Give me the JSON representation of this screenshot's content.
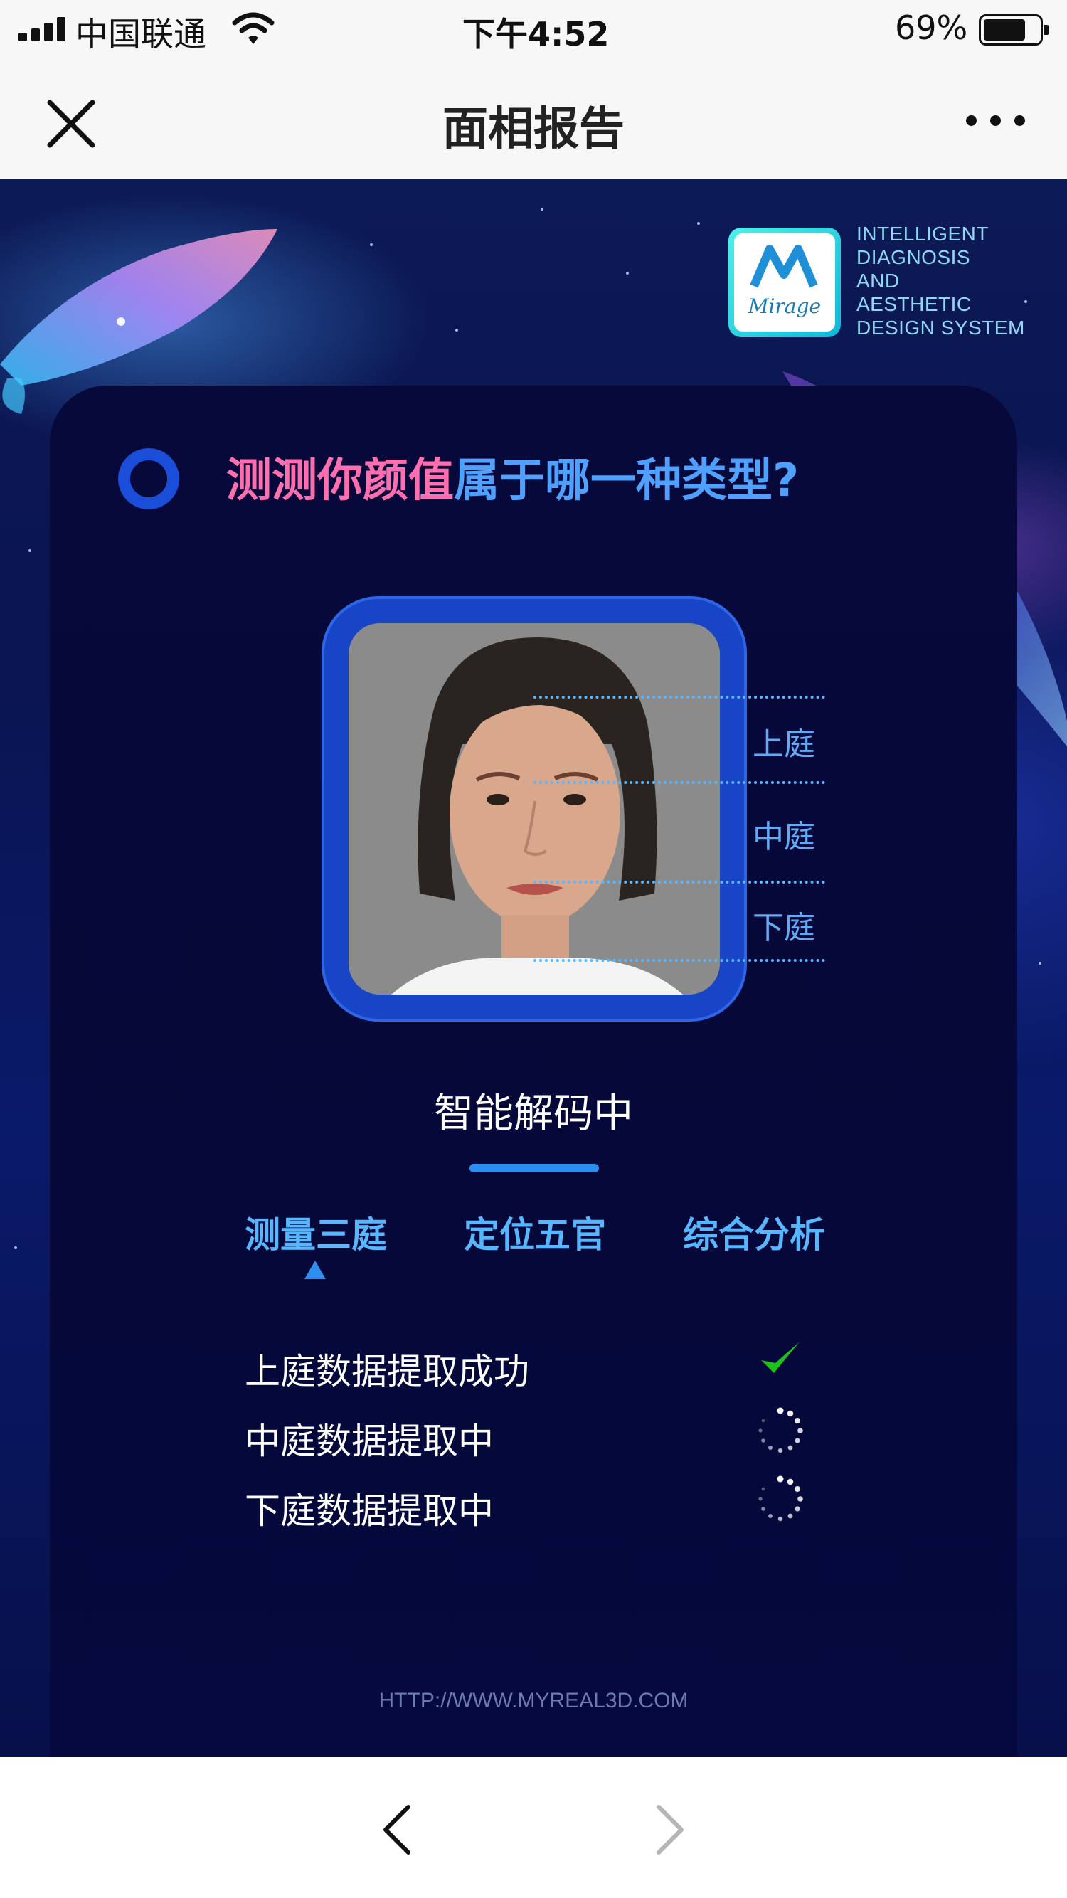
{
  "status_bar": {
    "carrier": "中国联通",
    "time": "下午4:52",
    "battery": "69%",
    "battery_level": 0.69
  },
  "nav": {
    "title": "面相报告",
    "close_icon": "close-icon",
    "more_icon": "more-dots-icon"
  },
  "logo": {
    "wordmark": "Mirage",
    "lines": [
      "INTELLIGENT",
      "DIAGNOSIS",
      "AND",
      "AESTHETIC",
      "DESIGN SYSTEM"
    ]
  },
  "heading": {
    "pink_part": "测测你颜值",
    "blue_part": "属于哪一种类型?"
  },
  "zones": [
    "上庭",
    "中庭",
    "下庭"
  ],
  "status": {
    "title": "智能解码中"
  },
  "tabs": [
    {
      "label": "测量三庭",
      "active": true
    },
    {
      "label": "定位五官",
      "active": false
    },
    {
      "label": "综合分析",
      "active": false
    }
  ],
  "steps": [
    {
      "label": "上庭数据提取成功",
      "state": "done",
      "icon": "checkmark-icon"
    },
    {
      "label": "中庭数据提取中",
      "state": "loading",
      "icon": "loading-spinner-icon"
    },
    {
      "label": "下庭数据提取中",
      "state": "loading",
      "icon": "loading-spinner-icon"
    }
  ],
  "footer": {
    "url": "HTTP://WWW.MYREAL3D.COM"
  },
  "toolbar": {
    "back_icon": "chevron-left-icon",
    "forward_icon": "chevron-right-icon"
  },
  "colors": {
    "accent_blue": "#4fa0ff",
    "accent_pink": "#ff6fb0",
    "frame_blue": "#1745c5",
    "check_green": "#1fc21a",
    "background_navy": "#0a1450"
  }
}
